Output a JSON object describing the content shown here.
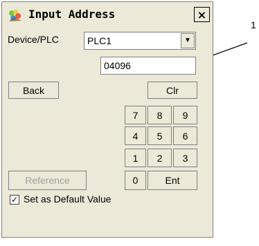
{
  "window": {
    "title": "Input Address",
    "close_label": "×"
  },
  "device": {
    "label": "Device/PLC",
    "value": "PLC1"
  },
  "address": {
    "value": "04096"
  },
  "buttons": {
    "back": "Back",
    "clr": "Clr",
    "reference": "Reference",
    "ent": "Ent"
  },
  "keypad": {
    "keys": [
      "7",
      "8",
      "9",
      "4",
      "5",
      "6",
      "1",
      "2",
      "3",
      "0"
    ]
  },
  "checkbox": {
    "label": "Set as Default Value",
    "checked": true,
    "mark": "✓"
  },
  "annotation": {
    "pointer_label": "1"
  },
  "icons": {
    "title_icon": "address-input-app-icon"
  },
  "colors": {
    "window_bg": "#ece9d8",
    "field_bg": "#ffffff",
    "disabled_text": "#a0a0a0"
  }
}
